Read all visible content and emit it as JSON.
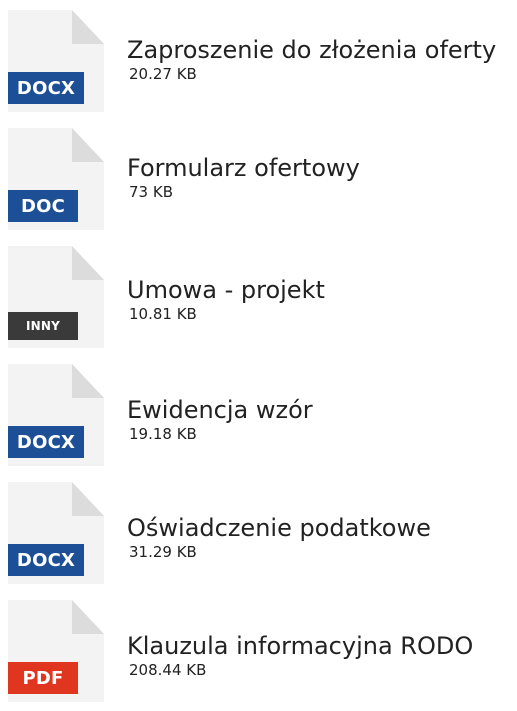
{
  "files": [
    {
      "name": "Zaproszenie do złożenia oferty",
      "size": "20.27 KB",
      "type": "DOCX",
      "badge_color": "#1d4f96"
    },
    {
      "name": "Formularz ofertowy",
      "size": "73 KB",
      "type": "DOC",
      "badge_color": "#1d4f96"
    },
    {
      "name": "Umowa - projekt",
      "size": "10.81 KB",
      "type": "INNY",
      "badge_color": "#3a3a3a"
    },
    {
      "name": "Ewidencja wzór",
      "size": "19.18 KB",
      "type": "DOCX",
      "badge_color": "#1d4f96"
    },
    {
      "name": "Oświadczenie podatkowe",
      "size": "31.29 KB",
      "type": "DOCX",
      "badge_color": "#1d4f96"
    },
    {
      "name": "Klauzula informacyjna RODO",
      "size": "208.44 KB",
      "type": "PDF",
      "badge_color": "#e0361f"
    }
  ]
}
